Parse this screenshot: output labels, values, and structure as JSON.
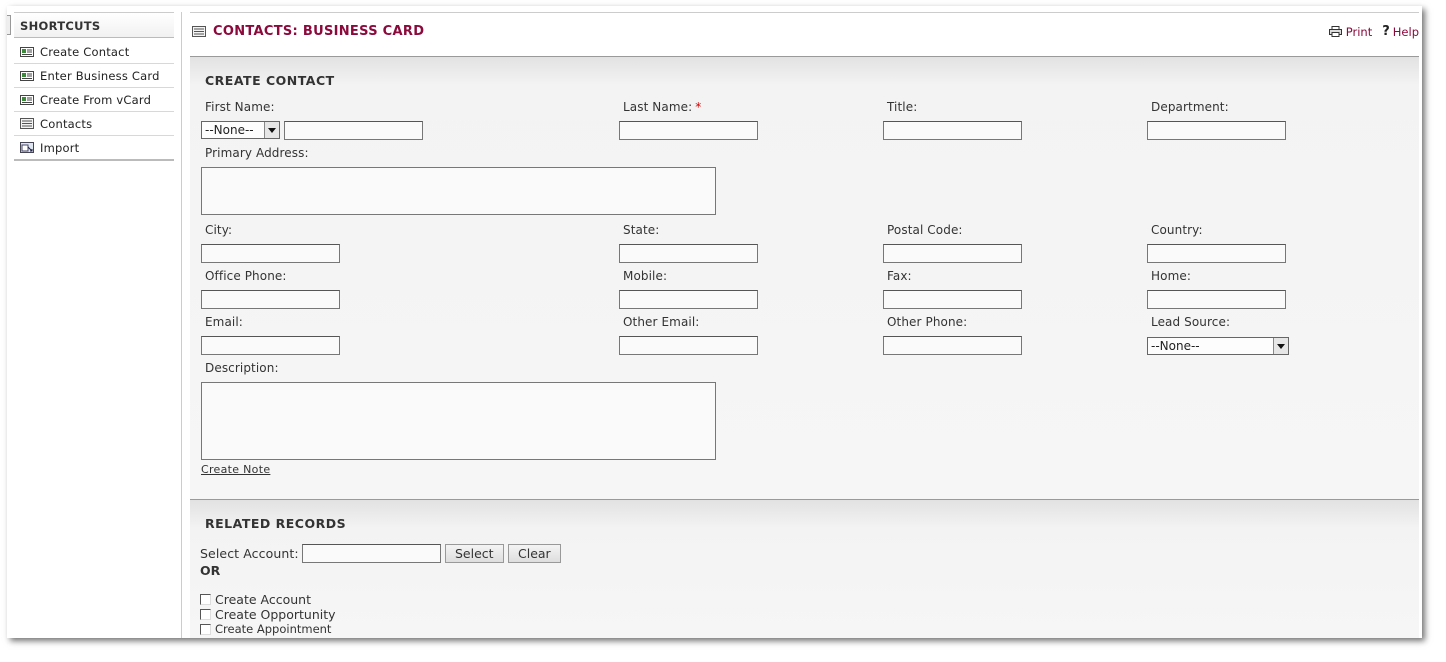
{
  "sidebar": {
    "title": "SHORTCUTS",
    "items": [
      {
        "label": "Create Contact",
        "icon": "contact-card-icon"
      },
      {
        "label": "Enter Business Card",
        "icon": "contact-card-icon"
      },
      {
        "label": "Create From vCard",
        "icon": "contact-card-icon"
      },
      {
        "label": "Contacts",
        "icon": "list-icon"
      },
      {
        "label": "Import",
        "icon": "import-icon"
      }
    ]
  },
  "header": {
    "title": "CONTACTS: BUSINESS CARD",
    "print_label": "Print",
    "help_label": "Help"
  },
  "create_contact": {
    "title": "CREATE CONTACT",
    "first_name_label": "First Name:",
    "salutation_value": "--None--",
    "last_name_label": "Last Name:",
    "required_marker": "*",
    "title_label": "Title:",
    "department_label": "Department:",
    "primary_address_label": "Primary Address:",
    "city_label": "City:",
    "state_label": "State:",
    "postal_code_label": "Postal Code:",
    "country_label": "Country:",
    "office_phone_label": "Office Phone:",
    "mobile_label": "Mobile:",
    "fax_label": "Fax:",
    "home_label": "Home:",
    "email_label": "Email:",
    "other_email_label": "Other Email:",
    "other_phone_label": "Other Phone:",
    "lead_source_label": "Lead Source:",
    "lead_source_value": "--None--",
    "description_label": "Description:",
    "create_note_label": "Create Note"
  },
  "related_records": {
    "title": "RELATED RECORDS",
    "select_account_label": "Select Account:",
    "select_button": "Select",
    "clear_button": "Clear",
    "or_label": "OR",
    "create_account_label": "Create Account",
    "create_opportunity_label": "Create Opportunity",
    "create_appointment_label": "Create Appointment"
  },
  "colors": {
    "title_accent": "#8b0a3c",
    "required": "#cc0000"
  }
}
